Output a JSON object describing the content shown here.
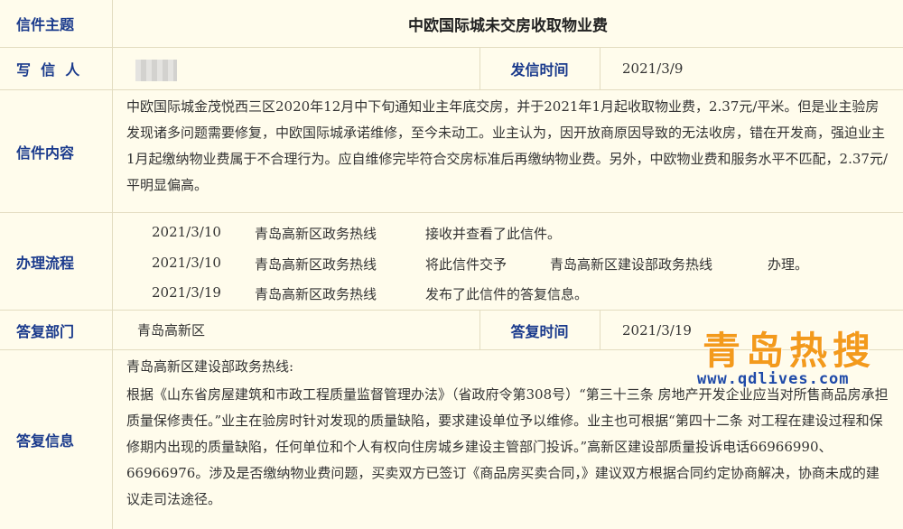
{
  "subject": {
    "label": "信件主题",
    "value": "中欧国际城未交房收取物业费"
  },
  "writer": {
    "label": "写  信  人",
    "send_time_label": "发信时间",
    "send_time": "2021/3/9"
  },
  "content": {
    "label": "信件内容",
    "text": "中欧国际城金茂悦西三区2020年12月中下旬通知业主年底交房，并于2021年1月起收取物业费，2.37元/平米。但是业主验房发现诸多问题需要修复，中欧国际城承诺维修，至今未动工。业主认为，因开放商原因导致的无法收房，错在开发商，强迫业主1月起缴纳物业费属于不合理行为。应自维修完毕符合交房标准后再缴纳物业费。另外，中欧物业费和服务水平不匹配，2.37元/平明显偏高。"
  },
  "process": {
    "label": "办理流程",
    "steps": [
      {
        "date": "2021/3/10",
        "dept": "青岛高新区政务热线",
        "action": "接收并查看了此信件。",
        "target": "",
        "tail": ""
      },
      {
        "date": "2021/3/10",
        "dept": "青岛高新区政务热线",
        "action": "将此信件交予",
        "target": "青岛高新区建设部政务热线",
        "tail": "办理。"
      },
      {
        "date": "2021/3/19",
        "dept": "青岛高新区政务热线",
        "action": "发布了此信件的答复信息。",
        "target": "",
        "tail": ""
      }
    ]
  },
  "reply_dept": {
    "label": "答复部门",
    "value": "青岛高新区",
    "time_label": "答复时间",
    "time": "2021/3/19"
  },
  "reply": {
    "label": "答复信息",
    "heading": "青岛高新区建设部政务热线:",
    "text": "根据《山东省房屋建筑和市政工程质量监督管理办法》（省政府令第308号）“第三十三条 房地产开发企业应当对所售商品房承担质量保修责任。”业主在验房时针对发现的质量缺陷，要求建设单位予以维修。业主也可根据“第四十二条   对工程在建设过程和保修期内出现的质量缺陷，任何单位和个人有权向住房城乡建设主管部门投诉。”高新区建设部质量投诉电话66966990、66966976。涉及是否缴纳物业费问题，买卖双方已签订《商品房买卖合同，》建议双方根据合同约定协商解决，协商未成的建议走司法途径。"
  },
  "watermark": {
    "name": "青岛热搜",
    "url": "www.qdlives.com"
  }
}
